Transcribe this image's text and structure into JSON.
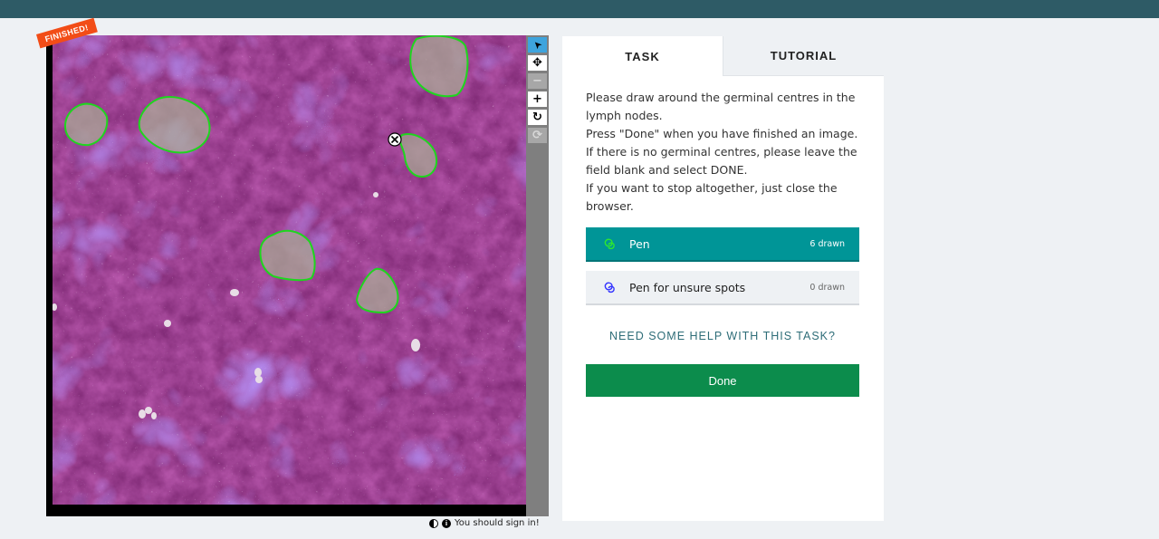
{
  "badge": {
    "finished": "FINISHED!"
  },
  "toolbar": {
    "select_icon": "pointer-icon",
    "pan_icon": "move-icon",
    "zoom_out_icon": "minus-icon",
    "zoom_in_icon": "plus-icon",
    "rotate_icon": "rotate-icon",
    "reset_icon": "reset-icon",
    "select_glyph": "➤",
    "pan_glyph": "✥",
    "zoom_out_glyph": "−",
    "zoom_in_glyph": "+",
    "rotate_glyph": "↻",
    "reset_glyph": "⟳"
  },
  "footer": {
    "signin_notice": "You should sign in!",
    "info_glyph": "i"
  },
  "tabs": {
    "task": "TASK",
    "tutorial": "TUTORIAL"
  },
  "instructions": {
    "line1": "Please draw around the germinal centres in the lymph nodes.",
    "line2": "Press \"Done\" when you have finished an image.",
    "line3": "If there is no germinal centres, please leave the field blank and select DONE.",
    "line4": "If you want to stop altogether, just close the browser."
  },
  "tools": [
    {
      "label": "Pen",
      "count": "6 drawn",
      "color": "#00d800"
    },
    {
      "label": "Pen for unsure spots",
      "count": "0 drawn",
      "color": "#3333ff"
    }
  ],
  "help": {
    "label": "NEED SOME HELP WITH THIS TASK?"
  },
  "done": {
    "label": "Done"
  },
  "colors": {
    "accent": "#009597",
    "done": "#0c8c4c",
    "ribbon": "#f24d17",
    "banner": "#2e5b66",
    "annotation": "#00d800"
  }
}
